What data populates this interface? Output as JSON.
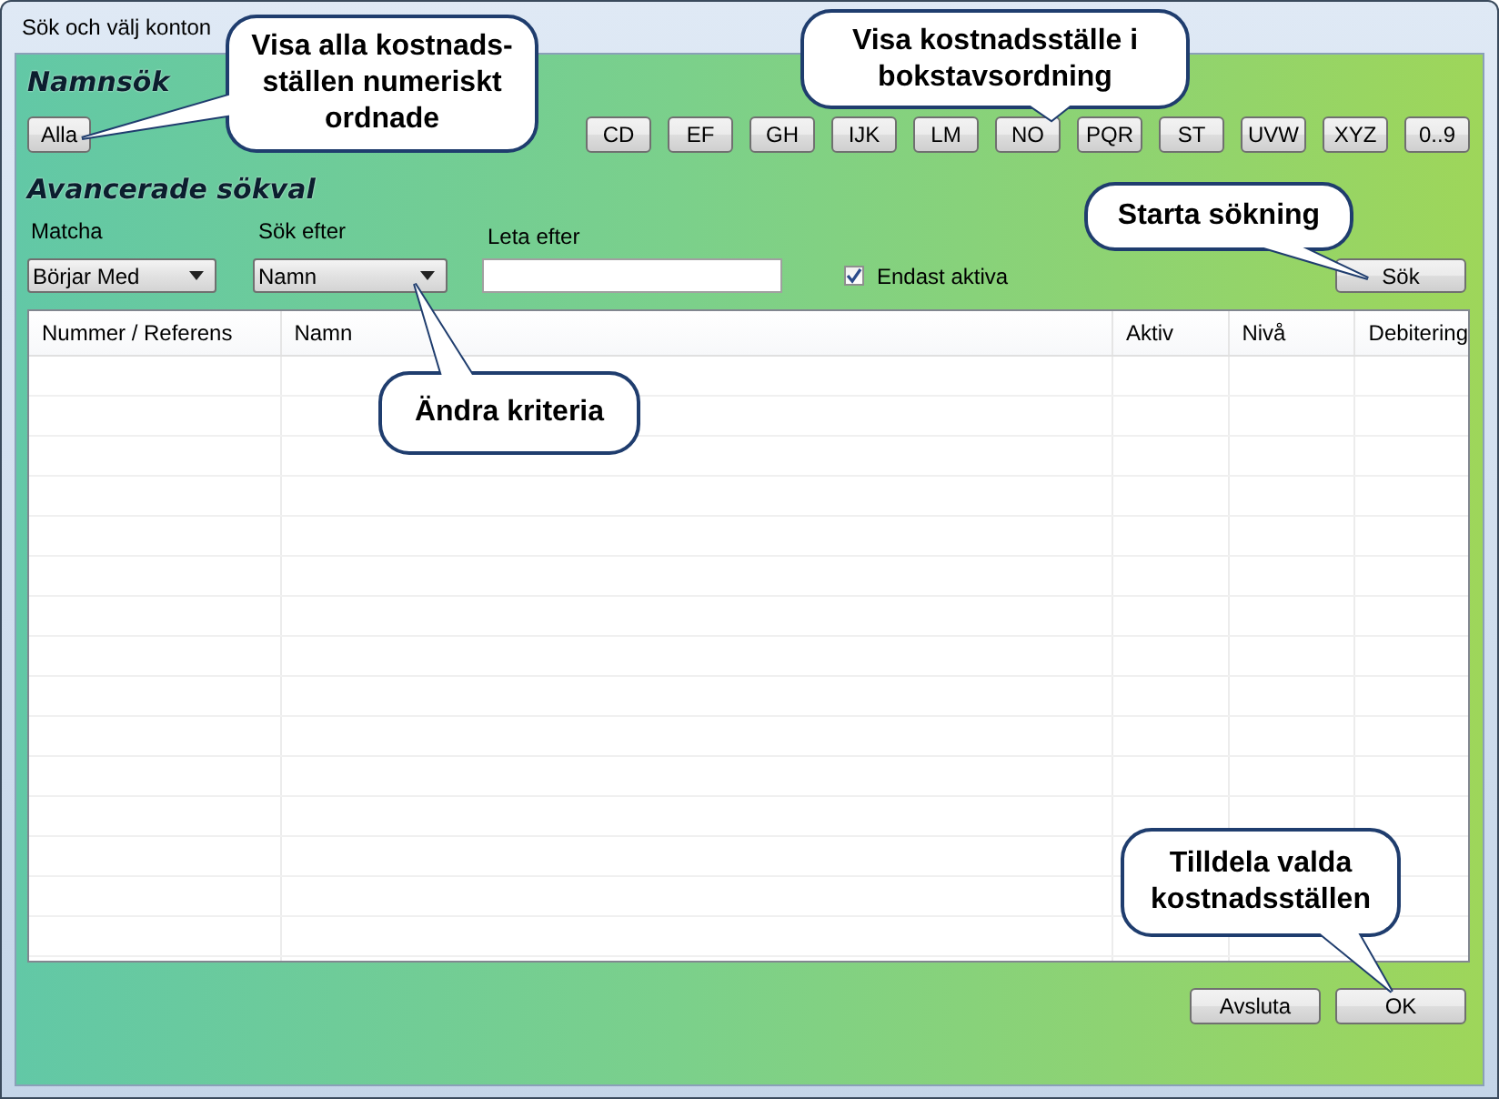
{
  "window": {
    "title": "Sök och välj konton"
  },
  "name_search": {
    "heading": "Namnsök",
    "buttons": [
      "Alla",
      "CD",
      "EF",
      "GH",
      "IJK",
      "LM",
      "NO",
      "PQR",
      "ST",
      "UVW",
      "XYZ",
      "0..9"
    ]
  },
  "advanced": {
    "heading": "Avancerade sökval",
    "match": {
      "label": "Matcha",
      "value": "Börjar Med"
    },
    "search_by": {
      "label": "Sök efter",
      "value": "Namn"
    },
    "find": {
      "label": "Leta efter"
    },
    "only_active": {
      "label": "Endast aktiva",
      "checked": true
    },
    "search_button": "Sök"
  },
  "table": {
    "columns": [
      "Nummer / Referens",
      "Namn",
      "Aktiv",
      "Nivå",
      "Debitering"
    ]
  },
  "buttons": [
    "Avsluta",
    "OK"
  ],
  "callouts": [
    {
      "text": "Visa alla kostnads-\nställen numeriskt\nordnade"
    },
    {
      "text": "Visa kostnadsställe i\nbokstavsordning"
    },
    {
      "text": "Starta sökning"
    },
    {
      "text": "Ändra kriteria"
    },
    {
      "text": "Tilldela valda\nkostnadsställen"
    }
  ]
}
